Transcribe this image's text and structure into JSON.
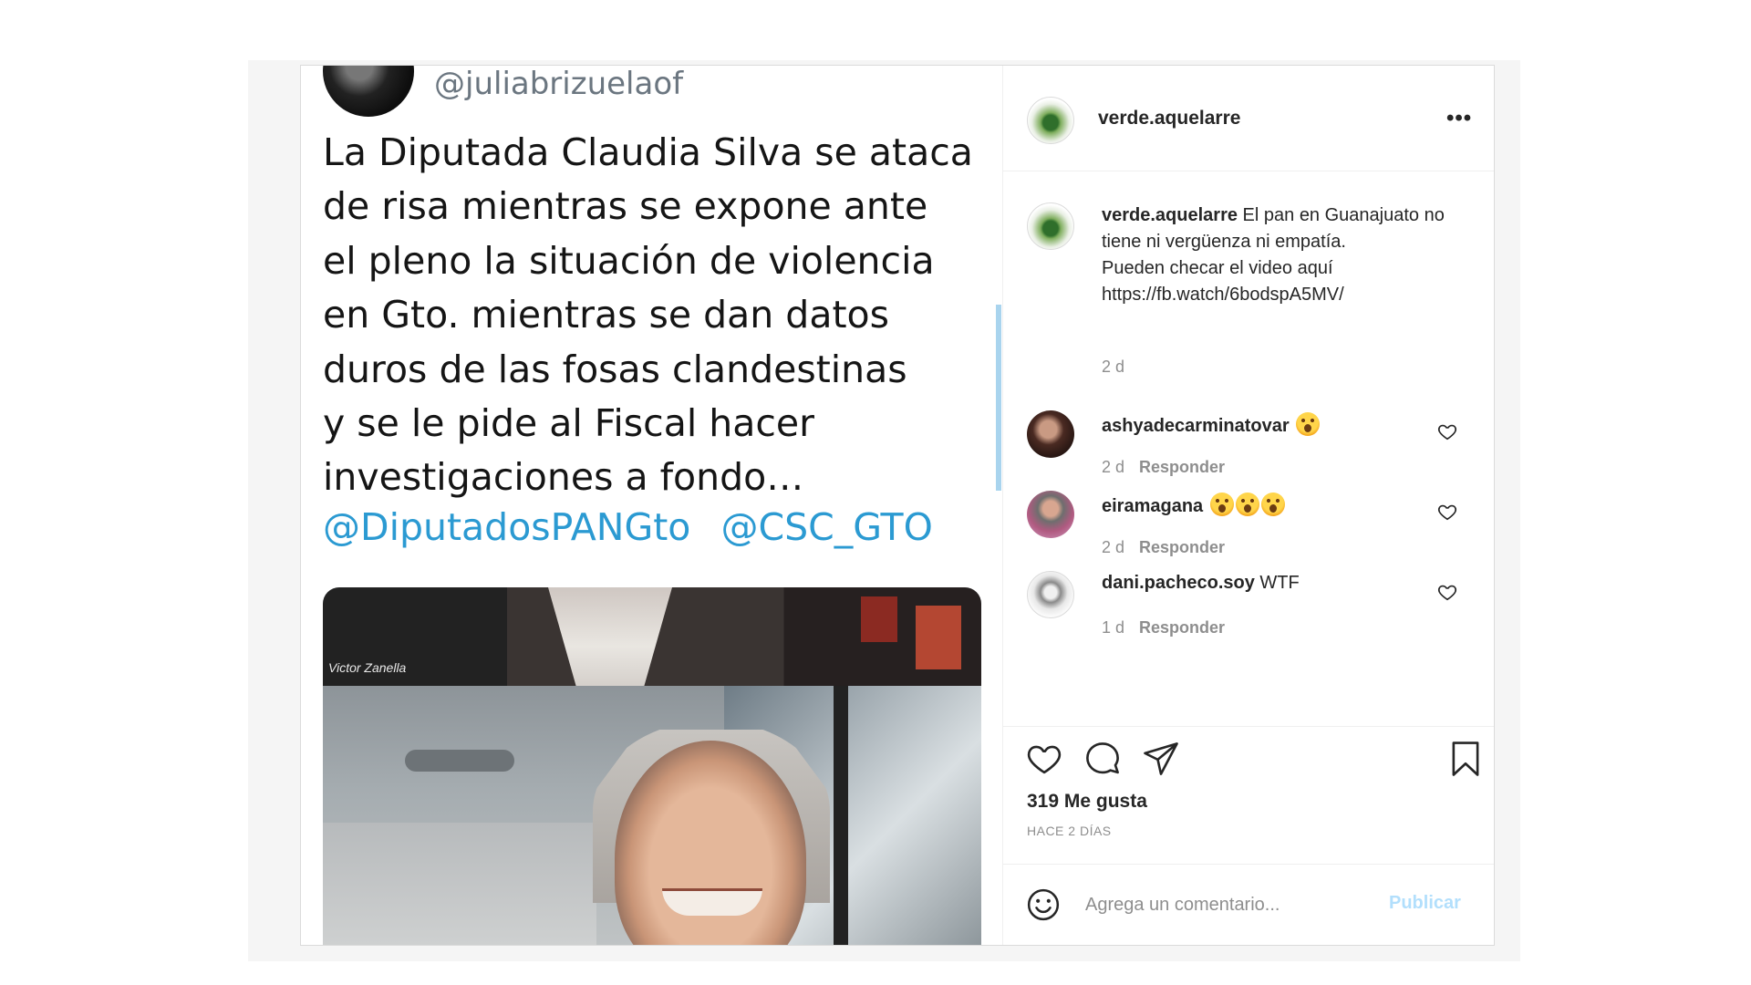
{
  "tweet": {
    "handle": "@juliabrizuelaof",
    "lines": [
      "La Diputada Claudia Silva se ataca",
      "de risa mientras se expone ante",
      "el pleno la situación de violencia",
      "en Gto. mientras se dan datos",
      "duros de las fosas clandestinas",
      "y se le pide al Fiscal hacer",
      "investigaciones a fondo…"
    ],
    "mentions": [
      "@DiputadosPANGto",
      "@CSC_GTO"
    ],
    "video_label": "Victor Zanella"
  },
  "post": {
    "username": "verde.aquelarre",
    "more_label": "•••",
    "caption": {
      "username": "verde.aquelarre",
      "text_1": "El pan en Guanajuato no tiene ni vergüenza ni empatía.",
      "text_2": "Pueden checar el video aquí",
      "link": "https://fb.watch/6bodspA5MV/",
      "time": "2 d"
    },
    "comments": [
      {
        "username": "ashyadecarminatovar",
        "text": "",
        "emoji_count": 1,
        "time": "2 d",
        "reply_label": "Responder",
        "avatar": "avatar-woman-dark-hair"
      },
      {
        "username": "eiramagana",
        "text": "",
        "emoji_count": 3,
        "time": "2 d",
        "reply_label": "Responder",
        "avatar": "avatar-woman-gray-hair"
      },
      {
        "username": "dani.pacheco.soy",
        "text": "WTF",
        "emoji_count": 0,
        "time": "1 d",
        "reply_label": "Responder",
        "avatar": "avatar-bw-portrait"
      }
    ],
    "likes": "319 Me gusta",
    "posted_ago": "HACE 2 DÍAS",
    "comment_placeholder": "Agrega un comentario...",
    "publish_label": "Publicar",
    "icons": [
      "heart-icon",
      "comment-icon",
      "share-icon",
      "bookmark-icon",
      "emoji-icon",
      "more-icon"
    ],
    "colors": {
      "text": "#262626",
      "muted": "#8e8e8e",
      "publish_disabled": "#b2dffc",
      "mention": "#2b9ad2"
    }
  }
}
